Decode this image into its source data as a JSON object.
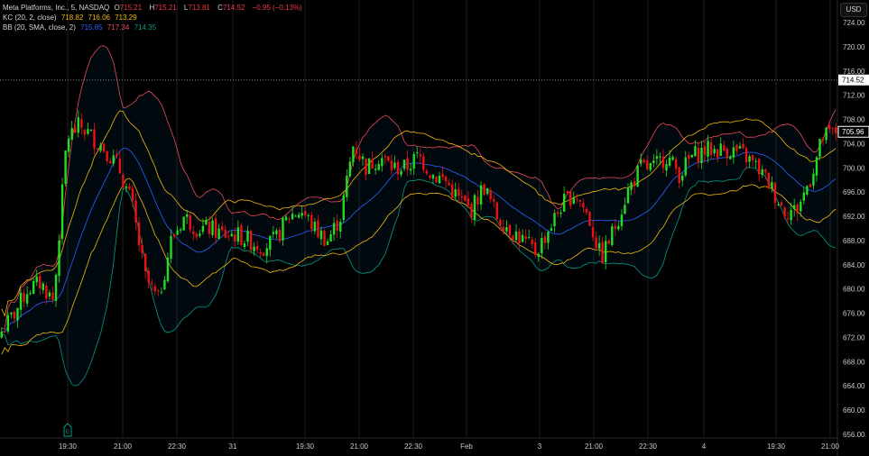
{
  "legend": {
    "symbol": "Meta Platforms, Inc., 5, NASDAQ",
    "o_label": "O",
    "o": "715.21",
    "h_label": "H",
    "h": "715.21",
    "l_label": "L",
    "l": "713.81",
    "c_label": "C",
    "c": "714.52",
    "change": "−0.95 (−0.13%)",
    "kc_label": "KC (20, 2, close)",
    "kc": [
      "718.82",
      "716.06",
      "713.29"
    ],
    "bb_label": "BB (20, SMA, close, 2)",
    "bb": [
      "715.85",
      "717.34",
      "714.35"
    ]
  },
  "currency": "USD",
  "colors": {
    "up": "#22dd22",
    "down": "#ee1111",
    "bb_basis": "#2962ff",
    "bb_upper": "#e84b5a",
    "bb_lower": "#089981",
    "kc": "#f0b90b",
    "bg": "#000000"
  },
  "chart_data": {
    "type": "candlestick",
    "ylim": [
      656,
      724
    ],
    "y_ticks": [
      "724.00",
      "720.00",
      "716.00",
      "712.00",
      "708.00",
      "704.00",
      "700.00",
      "696.00",
      "692.00",
      "688.00",
      "684.00",
      "680.00",
      "676.00",
      "672.00",
      "668.00",
      "664.00",
      "660.00",
      "656.00"
    ],
    "x_ticks": [
      "19:30",
      "21:00",
      "22:30",
      "31",
      "19:30",
      "21:00",
      "22:30",
      "Feb",
      "3",
      "21:00",
      "22:30",
      "4",
      "19:30",
      "21:00"
    ],
    "last_price_label": "714.52",
    "current_price_label": "705.96",
    "event_marker": "E",
    "close_path": [
      673,
      676,
      680,
      681,
      678,
      705,
      707,
      705,
      703,
      700,
      694,
      682,
      678,
      688,
      692,
      690,
      690,
      689,
      689,
      688,
      687,
      688,
      692,
      693,
      690,
      688,
      692,
      704,
      700,
      702,
      700,
      700,
      702,
      699,
      698,
      695,
      693,
      697,
      692,
      690,
      688,
      686,
      690,
      694,
      696,
      692,
      685,
      690,
      696,
      700,
      700,
      702,
      699,
      702,
      703,
      703,
      703,
      702,
      700,
      697,
      693,
      693,
      698,
      705,
      706
    ]
  }
}
